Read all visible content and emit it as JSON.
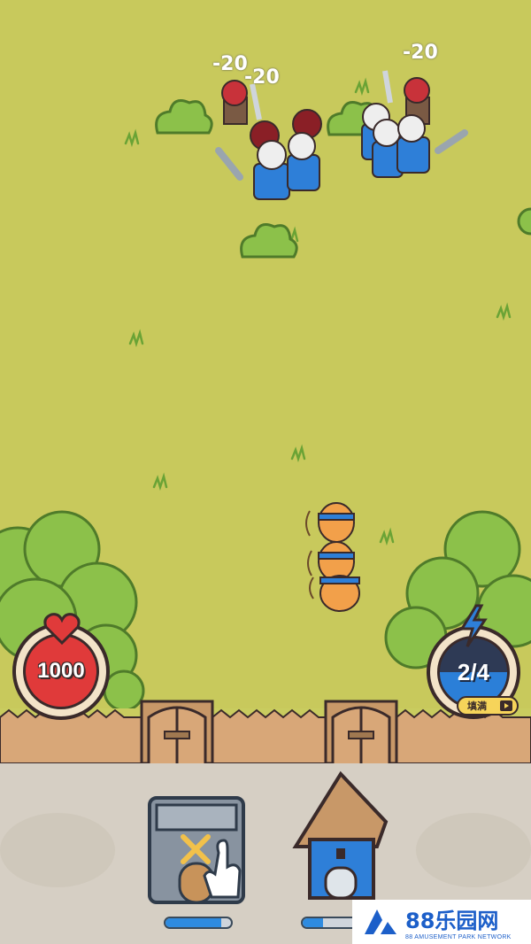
{
  "hud": {
    "health_value": "1000",
    "energy_value": "2/4",
    "energy_fill_label": "填满",
    "energy_fraction": 0.5
  },
  "combat": {
    "damage_texts": [
      "-20",
      "-20",
      "-20"
    ]
  },
  "build_menu": {
    "barracks_progress": 0.85,
    "archery_progress": 0.35
  },
  "watermark": {
    "brand": "88乐园网",
    "subtitle": "88 AMUSEMENT PARK NETWORK"
  },
  "colors": {
    "grass": "#c8c95c",
    "health_red": "#e03a3a",
    "energy_blue": "#2b7fd8",
    "ally_blue": "#2e7fd8",
    "enemy_red": "#c8323a"
  }
}
